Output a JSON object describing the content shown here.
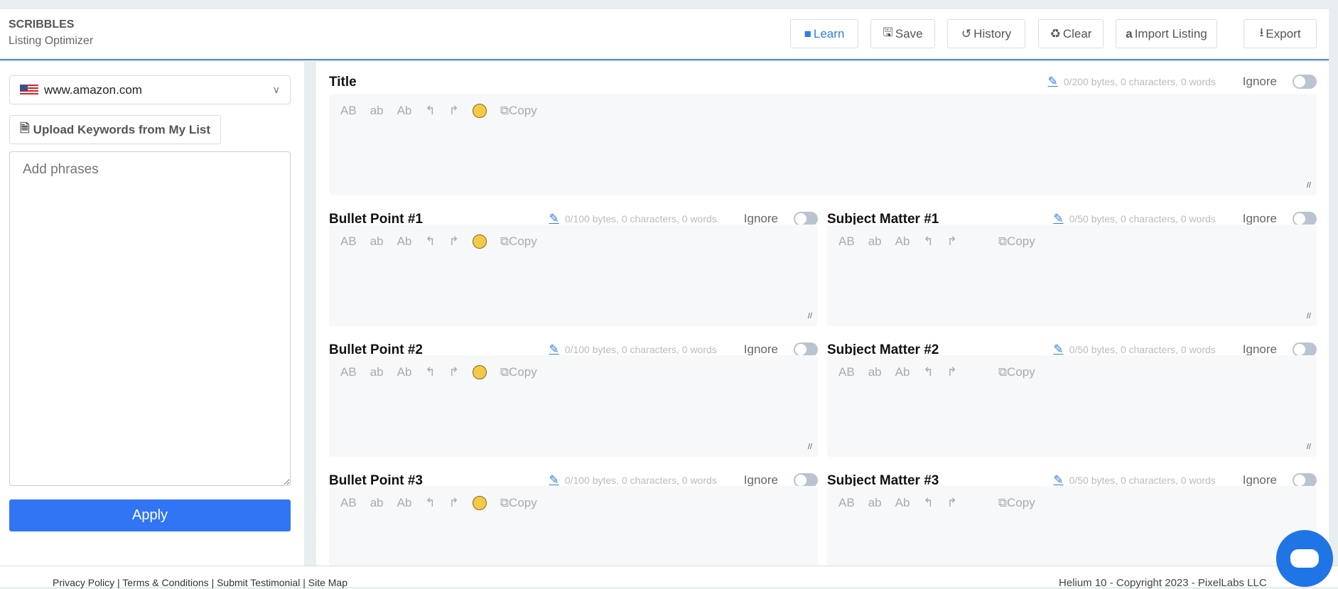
{
  "header": {
    "brand": "SCRIBBLES",
    "subtitle": "Listing Optimizer",
    "buttons": [
      {
        "label": "Learn",
        "icon": "video-icon"
      },
      {
        "label": "Save",
        "icon": "floppy-icon"
      },
      {
        "label": "History",
        "icon": "history-icon"
      },
      {
        "label": "Clear",
        "icon": "recycle-icon"
      },
      {
        "label": "Import Listing",
        "icon": "amazon-icon"
      },
      {
        "label": "Export",
        "icon": "download-icon"
      }
    ]
  },
  "sidebar": {
    "marketplace": "www.amazon.com",
    "upload_label": "Upload Keywords from My List",
    "phrases_placeholder": "Add phrases",
    "apply_label": "Apply"
  },
  "toolbar": {
    "upper": "AB",
    "lower": "ab",
    "title_case": "Ab",
    "undo": "↰",
    "redo": "↱",
    "copy": "Copy"
  },
  "ignore_label": "Ignore",
  "fields": [
    {
      "label": "Title",
      "stats": "0/200 bytes, 0 characters, 0 words",
      "emoji": true
    },
    {
      "label": "Bullet Point #1",
      "stats": "0/100 bytes, 0 characters, 0 words",
      "emoji": true
    },
    {
      "label": "Subject Matter #1",
      "stats": "0/50 bytes, 0 characters, 0 words",
      "emoji": false
    },
    {
      "label": "Bullet Point #2",
      "stats": "0/100 bytes, 0 characters, 0 words",
      "emoji": true
    },
    {
      "label": "Subject Matter #2",
      "stats": "0/50 bytes, 0 characters, 0 words",
      "emoji": false
    },
    {
      "label": "Bullet Point #3",
      "stats": "0/100 bytes, 0 characters, 0 words",
      "emoji": true
    },
    {
      "label": "Subject Matter #3",
      "stats": "0/50 bytes, 0 characters, 0 words",
      "emoji": false
    }
  ],
  "footer": {
    "links": "Privacy Policy | Terms & Conditions | Submit Testimonial | Site Map",
    "copyright": "Helium 10 - Copyright 2023 - PixelLabs LLC"
  },
  "colors": {
    "accent": "#3175f5",
    "header_line": "#4a86d0",
    "chat": "#1f74e6"
  }
}
